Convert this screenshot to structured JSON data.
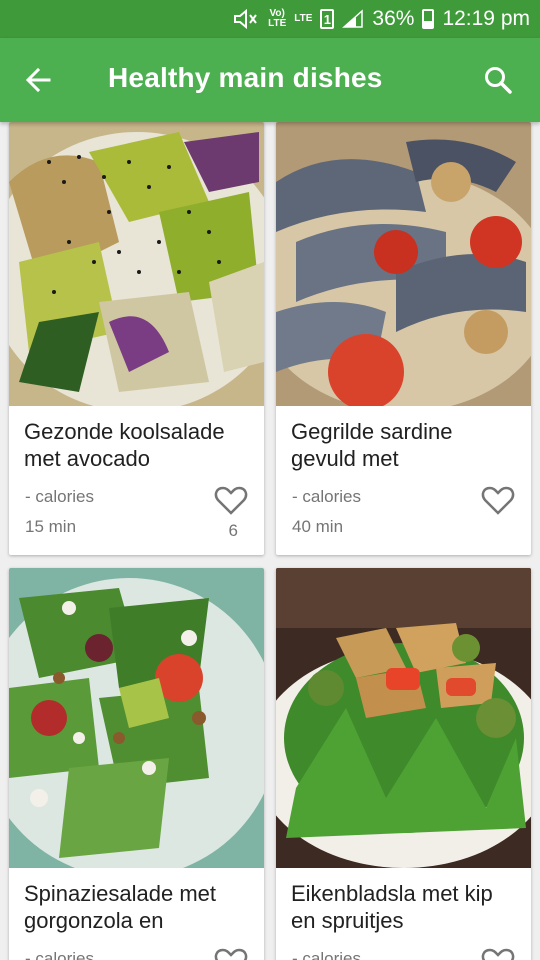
{
  "status_bar": {
    "volte": "Vo)\nLTE",
    "lte": "LTE",
    "sim": "1",
    "battery_percent": "36%",
    "battery_level": 0.36,
    "time": "12:19 pm"
  },
  "app_bar": {
    "title": "Healthy main dishes",
    "back_icon": "arrow-back-icon",
    "search_icon": "search-icon"
  },
  "recipes": [
    {
      "title": "Gezonde koolsalade met avocado",
      "calories": "- calories",
      "time": "15 min",
      "likes": "6"
    },
    {
      "title": "Gegrilde sardine gevuld met",
      "calories": "- calories",
      "time": "40 min",
      "likes": ""
    },
    {
      "title": "Spinaziesalade met gorgonzola en",
      "calories": "- calories",
      "time": "",
      "likes": ""
    },
    {
      "title": "Eikenbladsla met kip en spruitjes",
      "calories": "- calories",
      "time": "",
      "likes": ""
    }
  ],
  "colors": {
    "status_bar": "#3f9a3a",
    "app_bar": "#4caf50",
    "background": "#efefef"
  }
}
